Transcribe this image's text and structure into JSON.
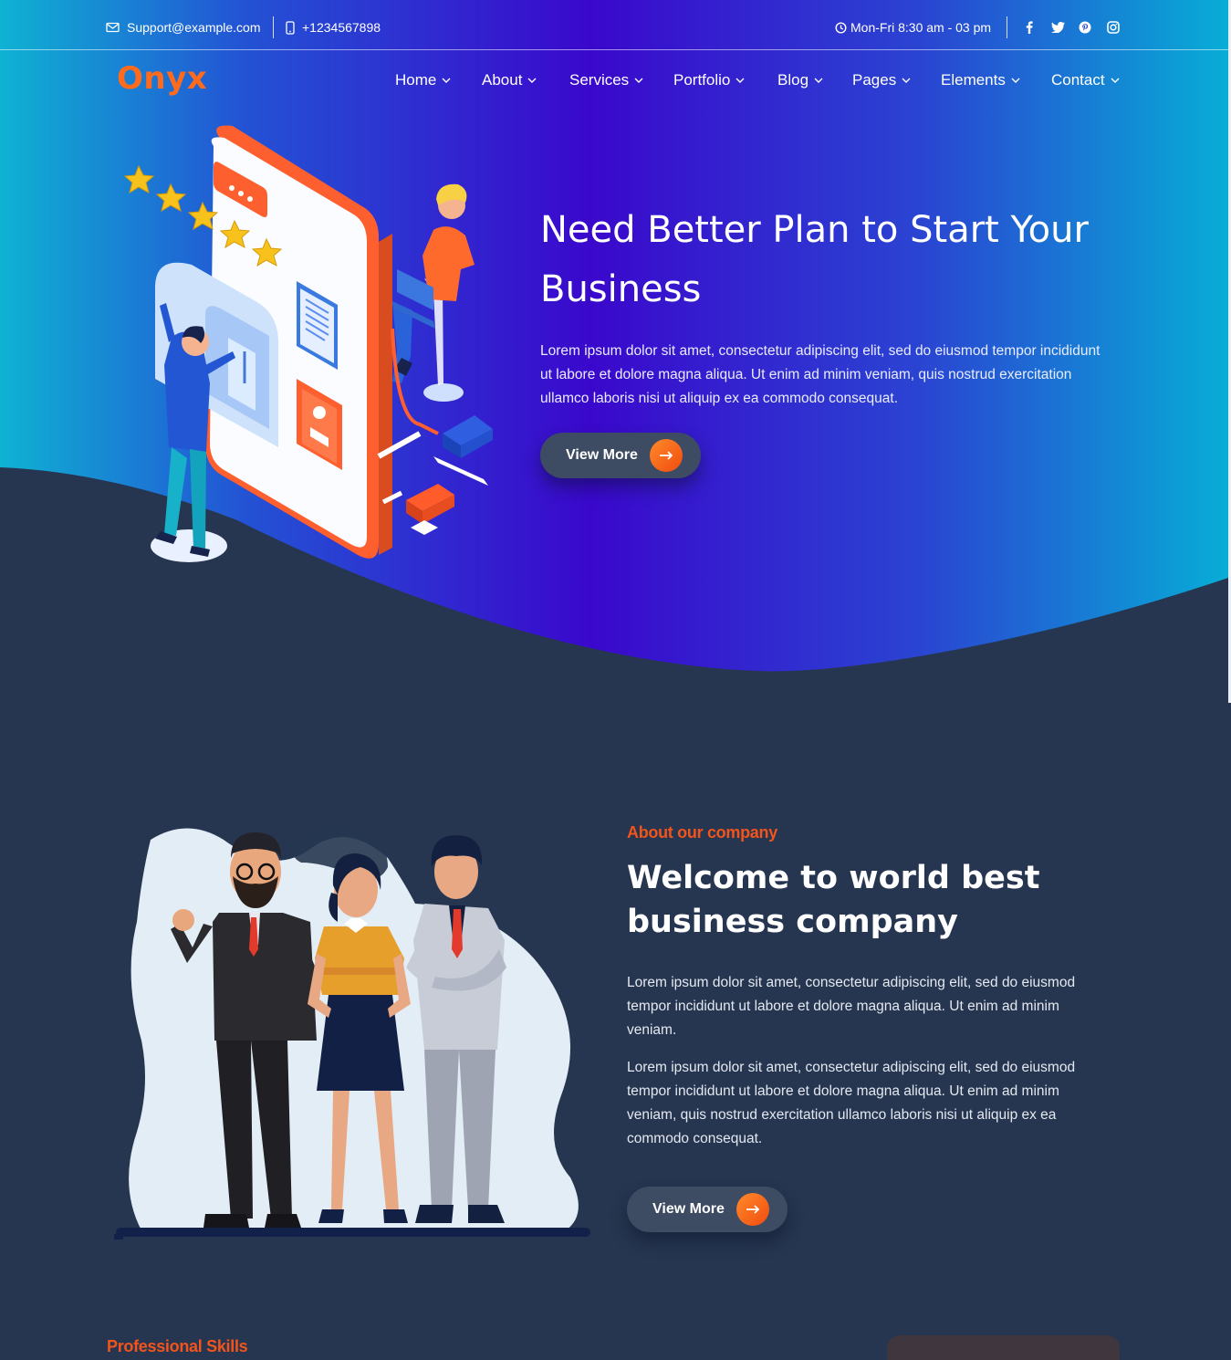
{
  "topbar": {
    "email": "Support@example.com",
    "phone": "+1234567898",
    "hours": "Mon-Fri 8:30 am - 03 pm",
    "socials": [
      "facebook-icon",
      "twitter-icon",
      "pinterest-icon",
      "instagram-icon"
    ]
  },
  "brand": {
    "logo": "Onyx"
  },
  "nav": {
    "items": [
      {
        "label": "Home"
      },
      {
        "label": "About"
      },
      {
        "label": "Services"
      },
      {
        "label": "Portfolio"
      },
      {
        "label": "Blog"
      },
      {
        "label": "Pages"
      },
      {
        "label": "Elements"
      },
      {
        "label": "Contact"
      }
    ]
  },
  "hero": {
    "title": "Need Better Plan to Start Your Business",
    "text": "Lorem ipsum dolor sit amet, consectetur adipiscing elit, sed do eiusmod tempor incididunt ut labore et dolore magna aliqua. Ut enim ad minim veniam, quis nostrud exercitation ullamco laboris nisi ut aliquip ex ea commodo consequat.",
    "button": "View More"
  },
  "about": {
    "tag": "About our company",
    "title": "Welcome to world best business company",
    "p1": "Lorem ipsum dolor sit amet, consectetur adipiscing elit, sed do eiusmod tempor incididunt ut labore et dolore magna aliqua. Ut enim ad minim veniam.",
    "p2": "Lorem ipsum dolor sit amet, consectetur adipiscing elit, sed do eiusmod tempor incididunt ut labore et dolore magna aliqua. Ut enim ad minim veniam, quis nostrud exercitation ullamco laboris nisi ut aliquip ex ea commodo consequat.",
    "button": "View More"
  },
  "skills": {
    "tag": "Professional Skills"
  },
  "colors": {
    "accent": "#fe6b1c",
    "tag": "#f2541b",
    "page_bg": "#263650",
    "hero_gradient": [
      "#06b2d2",
      "#3a0acb",
      "#06a9d6"
    ],
    "button_bg": "#3d4b63"
  }
}
